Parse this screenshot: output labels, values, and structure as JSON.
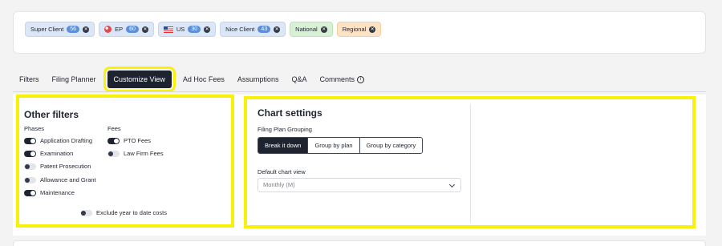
{
  "chips": [
    {
      "label": "Super Client",
      "count": "56",
      "style": "blue",
      "flag": ""
    },
    {
      "label": "EP",
      "count": "60",
      "style": "blue",
      "flag": "ep"
    },
    {
      "label": "US",
      "count": "30",
      "style": "blue",
      "flag": "us"
    },
    {
      "label": "Nice Client",
      "count": "43",
      "style": "blue",
      "flag": ""
    },
    {
      "label": "National",
      "count": "",
      "style": "green",
      "flag": ""
    },
    {
      "label": "Regional",
      "count": "",
      "style": "orange",
      "flag": ""
    }
  ],
  "tabs": [
    {
      "label": "Filters"
    },
    {
      "label": "Filing Planner"
    },
    {
      "label": "Customize View"
    },
    {
      "label": "Ad Hoc Fees"
    },
    {
      "label": "Assumptions"
    },
    {
      "label": "Q&A"
    },
    {
      "label": "Comments"
    }
  ],
  "other_filters": {
    "title": "Other filters",
    "phases_label": "Phases",
    "fees_label": "Fees",
    "phases": [
      {
        "label": "Application Drafting",
        "on": true
      },
      {
        "label": "Examination",
        "on": true
      },
      {
        "label": "Patent Prosecution",
        "on": false
      },
      {
        "label": "Allowance and Grant",
        "on": false
      },
      {
        "label": "Maintenance",
        "on": true
      }
    ],
    "fees": [
      {
        "label": "PTO Fees",
        "on": true
      },
      {
        "label": "Law Firm Fees",
        "on": false
      }
    ],
    "exclude": {
      "label": "Exclude year to date costs",
      "on": false
    }
  },
  "chart_settings": {
    "title": "Chart settings",
    "grouping_label": "Filing Plan Grouping",
    "grouping_options": [
      "Break it down",
      "Group by plan",
      "Group by category"
    ],
    "grouping_selected": "Break it down",
    "view_label": "Default chart view",
    "view_value": "Monthly (M)"
  },
  "colors": {
    "highlight": "#f8f20a",
    "active_dark": "#1e2330"
  }
}
